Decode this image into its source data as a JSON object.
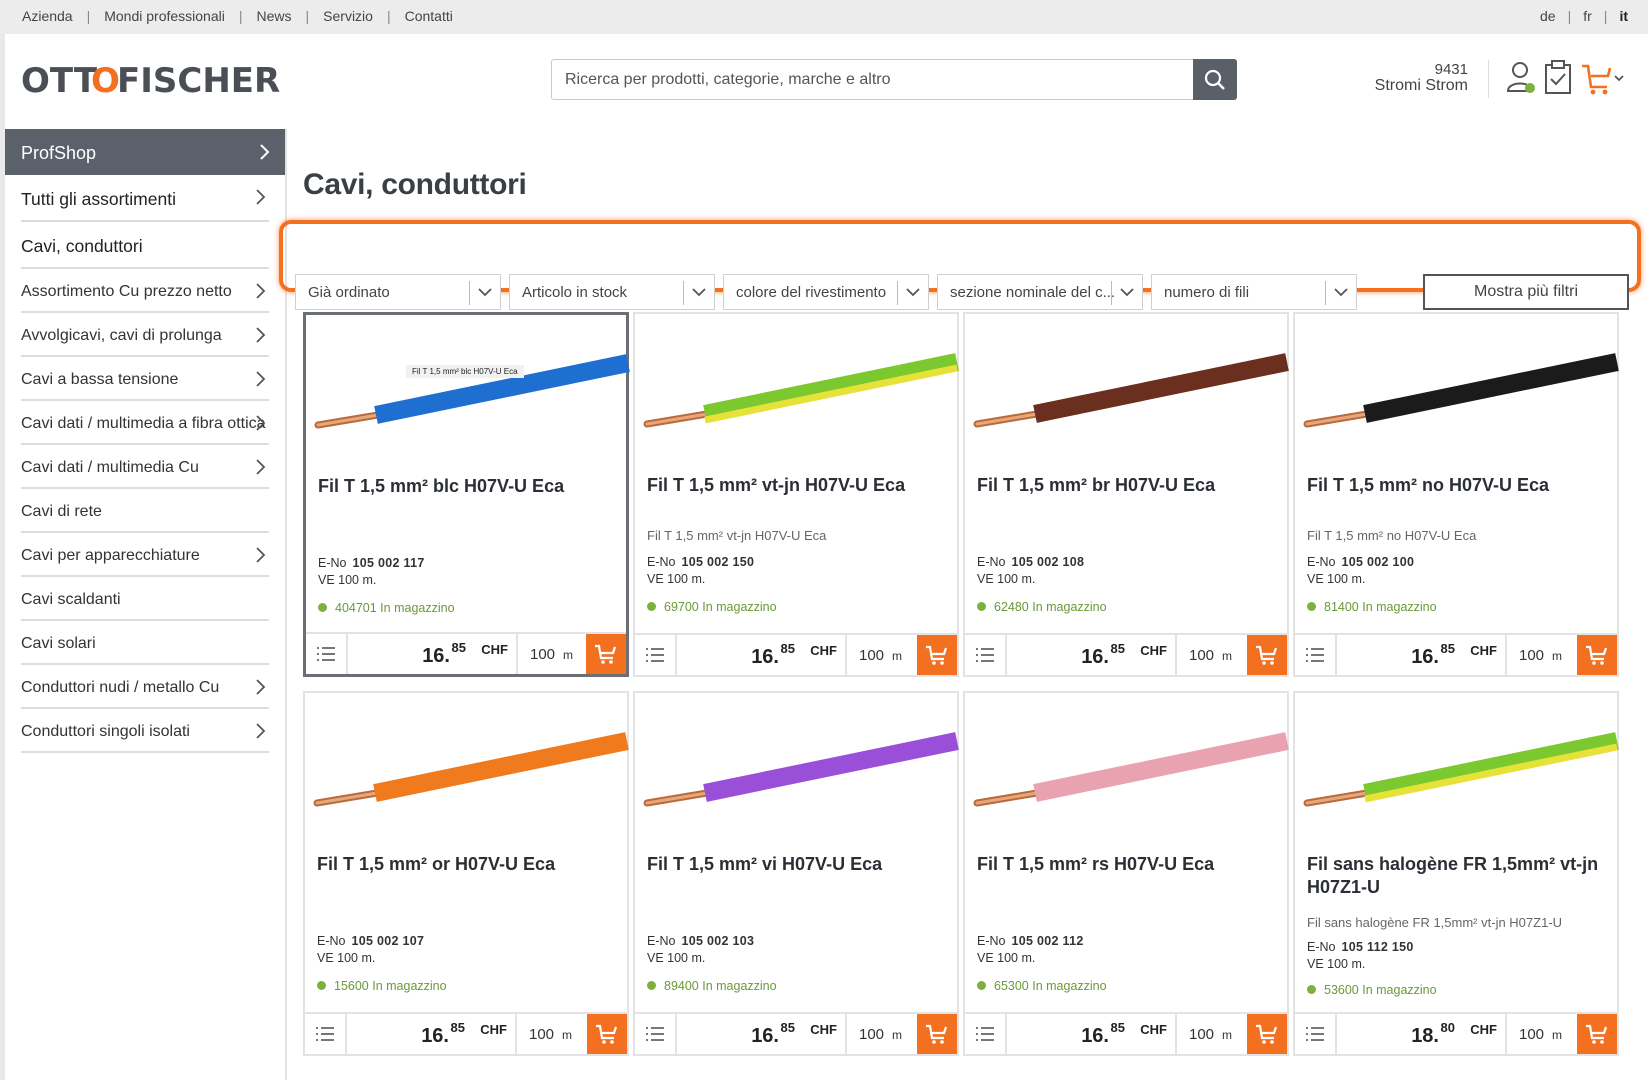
{
  "topbar": {
    "links": [
      "Azienda",
      "Mondi professionali",
      "News",
      "Servizio",
      "Contatti"
    ],
    "languages": [
      "de",
      "fr",
      "it"
    ],
    "active_language": "it"
  },
  "header": {
    "logo_text": "OTTOFISCHER",
    "search_placeholder": "Ricerca per prodotti, categorie, marche e altro",
    "customer_number": "9431",
    "customer_name": "Stromi Strom"
  },
  "sidebar": {
    "head": "ProfShop",
    "items": [
      {
        "label": "Tutti gli assortimenti",
        "chevron": true,
        "big": true
      },
      {
        "label": "Cavi, conduttori",
        "chevron": false,
        "big": true
      },
      {
        "label": "Assortimento Cu prezzo netto",
        "chevron": true
      },
      {
        "label": "Avvolgicavi, cavi di prolunga",
        "chevron": true
      },
      {
        "label": "Cavi a bassa tensione",
        "chevron": true
      },
      {
        "label": "Cavi dati / multimedia a fibra ottica",
        "chevron": true
      },
      {
        "label": "Cavi dati / multimedia Cu",
        "chevron": true
      },
      {
        "label": "Cavi di rete",
        "chevron": false
      },
      {
        "label": "Cavi per apparecchiature",
        "chevron": true
      },
      {
        "label": "Cavi scaldanti",
        "chevron": false
      },
      {
        "label": "Cavi solari",
        "chevron": false
      },
      {
        "label": "Conduttori nudi / metallo Cu",
        "chevron": true
      },
      {
        "label": "Conduttori singoli isolati",
        "chevron": true
      }
    ]
  },
  "page_title": "Cavi, conduttori",
  "filters": {
    "items": [
      "Già ordinato",
      "Articolo in stock",
      "colore del rivestimento",
      "sezione nominale del c...",
      "numero di fili"
    ],
    "more_label": "Mostra più filtri"
  },
  "products": [
    {
      "name": "Fil T 1,5 mm² blc H07V-U Eca",
      "sub": "",
      "eno": "105 002 117",
      "ve": "VE 100 m.",
      "stock": "404701 In magazzino",
      "price_int": "16.",
      "price_dec": "85",
      "currency": "CHF",
      "qty": "100",
      "unit": "m",
      "color": "#1f6fd1",
      "img_label": "Fil T 1,5 mm² blc H07V-U Eca"
    },
    {
      "name": "Fil T 1,5 mm² vt-jn H07V-U Eca",
      "sub": "Fil T 1,5 mm² vt-jn H07V-U Eca",
      "eno": "105 002 150",
      "ve": "VE 100 m.",
      "stock": "69700 In magazzino",
      "price_int": "16.",
      "price_dec": "85",
      "currency": "CHF",
      "qty": "100",
      "unit": "m",
      "color": "#7cc82f",
      "color2": "#e6e23a"
    },
    {
      "name": "Fil T 1,5 mm² br H07V-U Eca",
      "sub": "",
      "eno": "105 002 108",
      "ve": "VE 100 m.",
      "stock": "62480 In magazzino",
      "price_int": "16.",
      "price_dec": "85",
      "currency": "CHF",
      "qty": "100",
      "unit": "m",
      "color": "#6b2f1f"
    },
    {
      "name": "Fil T 1,5 mm² no H07V-U Eca",
      "sub": "Fil T 1,5 mm² no H07V-U Eca",
      "eno": "105 002 100",
      "ve": "VE 100 m.",
      "stock": "81400 In magazzino",
      "price_int": "16.",
      "price_dec": "85",
      "currency": "CHF",
      "qty": "100",
      "unit": "m",
      "color": "#1b1b1b"
    },
    {
      "name": "Fil T 1,5 mm² or H07V-U Eca",
      "sub": "",
      "eno": "105 002 107",
      "ve": "VE 100 m.",
      "stock": "15600 In magazzino",
      "price_int": "16.",
      "price_dec": "85",
      "currency": "CHF",
      "qty": "100",
      "unit": "m",
      "color": "#f07a1e"
    },
    {
      "name": "Fil T 1,5 mm² vi H07V-U Eca",
      "sub": "",
      "eno": "105 002 103",
      "ve": "VE 100 m.",
      "stock": "89400 In magazzino",
      "price_int": "16.",
      "price_dec": "85",
      "currency": "CHF",
      "qty": "100",
      "unit": "m",
      "color": "#9a4fd8"
    },
    {
      "name": "Fil T 1,5 mm² rs H07V-U Eca",
      "sub": "",
      "eno": "105 002 112",
      "ve": "VE 100 m.",
      "stock": "65300 In magazzino",
      "price_int": "16.",
      "price_dec": "85",
      "currency": "CHF",
      "qty": "100",
      "unit": "m",
      "color": "#e9a3b0"
    },
    {
      "name": "Fil sans halogène FR 1,5mm² vt-jn H07Z1-U",
      "sub": "Fil sans halogène FR 1,5mm² vt-jn H07Z1-U",
      "eno": "105 112 150",
      "ve": "VE 100 m.",
      "stock": "53600 In magazzino",
      "price_int": "18.",
      "price_dec": "80",
      "currency": "CHF",
      "qty": "100",
      "unit": "m",
      "color": "#7cc82f",
      "color2": "#e6e23a"
    }
  ],
  "labels": {
    "eno_prefix": "E-No"
  },
  "colors": {
    "accent": "#f37021",
    "sidebar_head": "#5b616a",
    "stock_green": "#7bb13c"
  }
}
